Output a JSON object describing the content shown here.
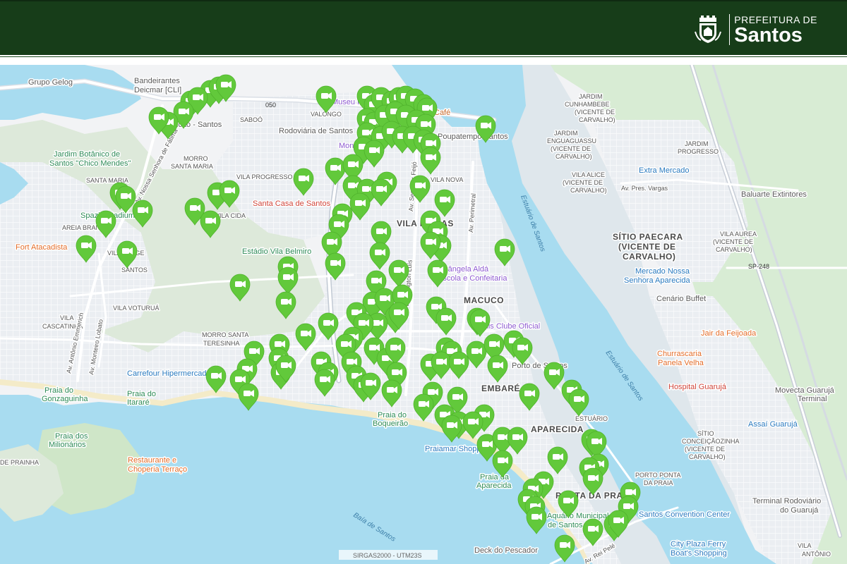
{
  "header": {
    "brand_line1": "PREFEITURA DE",
    "brand_line2": "Santos",
    "bg_color": "#173d19"
  },
  "map": {
    "marker_color": "#62c93b",
    "marker_icon": "video-camera-icon",
    "scale_text": "SIRGAS2000 - UTM23S",
    "water_labels": [
      "Estuário de Santos",
      "Estuário de Santos",
      "Baía de Santos"
    ],
    "neighborhoods": [
      "MACUCO",
      "EMBARÉ",
      "APARECIDA",
      "PONTA DA PRAIA",
      "VILA NOVA",
      "VALONGO",
      "SABOÓ",
      "SANTA MARIA",
      "VILA PROGRESSO",
      "MORRO SANTA MARIA",
      "AREIA BRANCA",
      "VILA VOTURUÁ",
      "VILA CASCATINHA",
      "MORRO SANTA TERESINHA",
      "ESTUÁRIO",
      "VILA MATIAS",
      "SANTOS",
      "SÍTIO PAECARA (VICENTE DE CARVALHO)",
      "VILA ALICE (VICENTE DE CARVALHO)",
      "VILA AUREA (VICENTE DE CARVALHO)",
      "JARDIM CUNHAMBEBE (VICENTE DE CARVALHO)",
      "JARDIM ENGUAGUASSU (VICENTE DE CARVALHO)",
      "JARDIM PROGRESSO",
      "SÍTIO CONCEIÇÃOZINHA (VICENTE DE CARVALHO)",
      "PORTO PONTA DA PRAIA",
      "VILA JORGE",
      "MORRO PRAINHA"
    ],
    "pois": [
      "Bandeirantes Deicmar [CLI]",
      "Grupo Gelog",
      "Museu Pelé",
      "Rodoviária de Santos",
      "Poupatempo Santos",
      "Café",
      "Jardim Botânico de Santos \"Chico Mendes\"",
      "Santa Casa de Santos",
      "Estádio Vila Belmiro",
      "Spazio Stadium",
      "Fort Atacadista",
      "Carrefour Hipermercado",
      "Praia do Gonzaguinha",
      "Praia do Itararé",
      "Praia dos Milionários",
      "Restaurante e Choperia Terraço",
      "Praia do Boqueirão",
      "Praia da Aparecida",
      "Aquário Municipal de Santos",
      "Deck do Pescador",
      "Santos Convention Center",
      "City Plaza Ferry Boat's Shopping",
      "Terminal Rodoviário do Guarujá",
      "Hospital Guarujá",
      "Assaí Guarujá",
      "Movecta Guarujá Terminal",
      "Jair da Feijoada",
      "Churrascaria Panela Velha",
      "Cenário Buffet",
      "Mercado Nossa Senhora Aparecida",
      "Baluarte Extintores",
      "Extra Mercado",
      "Zizângela Aldá Escola e Confeitaria",
      "Tennis Clube Oficial",
      "Porto de Santos",
      "Praiamar Shopping",
      "Estádio - Santos",
      "Montefiore Conveniador"
    ],
    "roads": [
      "Av. Antônio Emmerich",
      "Av. Monteiro Lobato",
      "Av. Nossa Senhora de Fátima",
      "Av. Washington Luís",
      "Av. Perimetral",
      "Av. Pres. Vargas",
      "Av. Rei Pelé",
      "Av. Senador Feijó",
      "SP-248",
      "050"
    ],
    "marker_count": 174
  }
}
